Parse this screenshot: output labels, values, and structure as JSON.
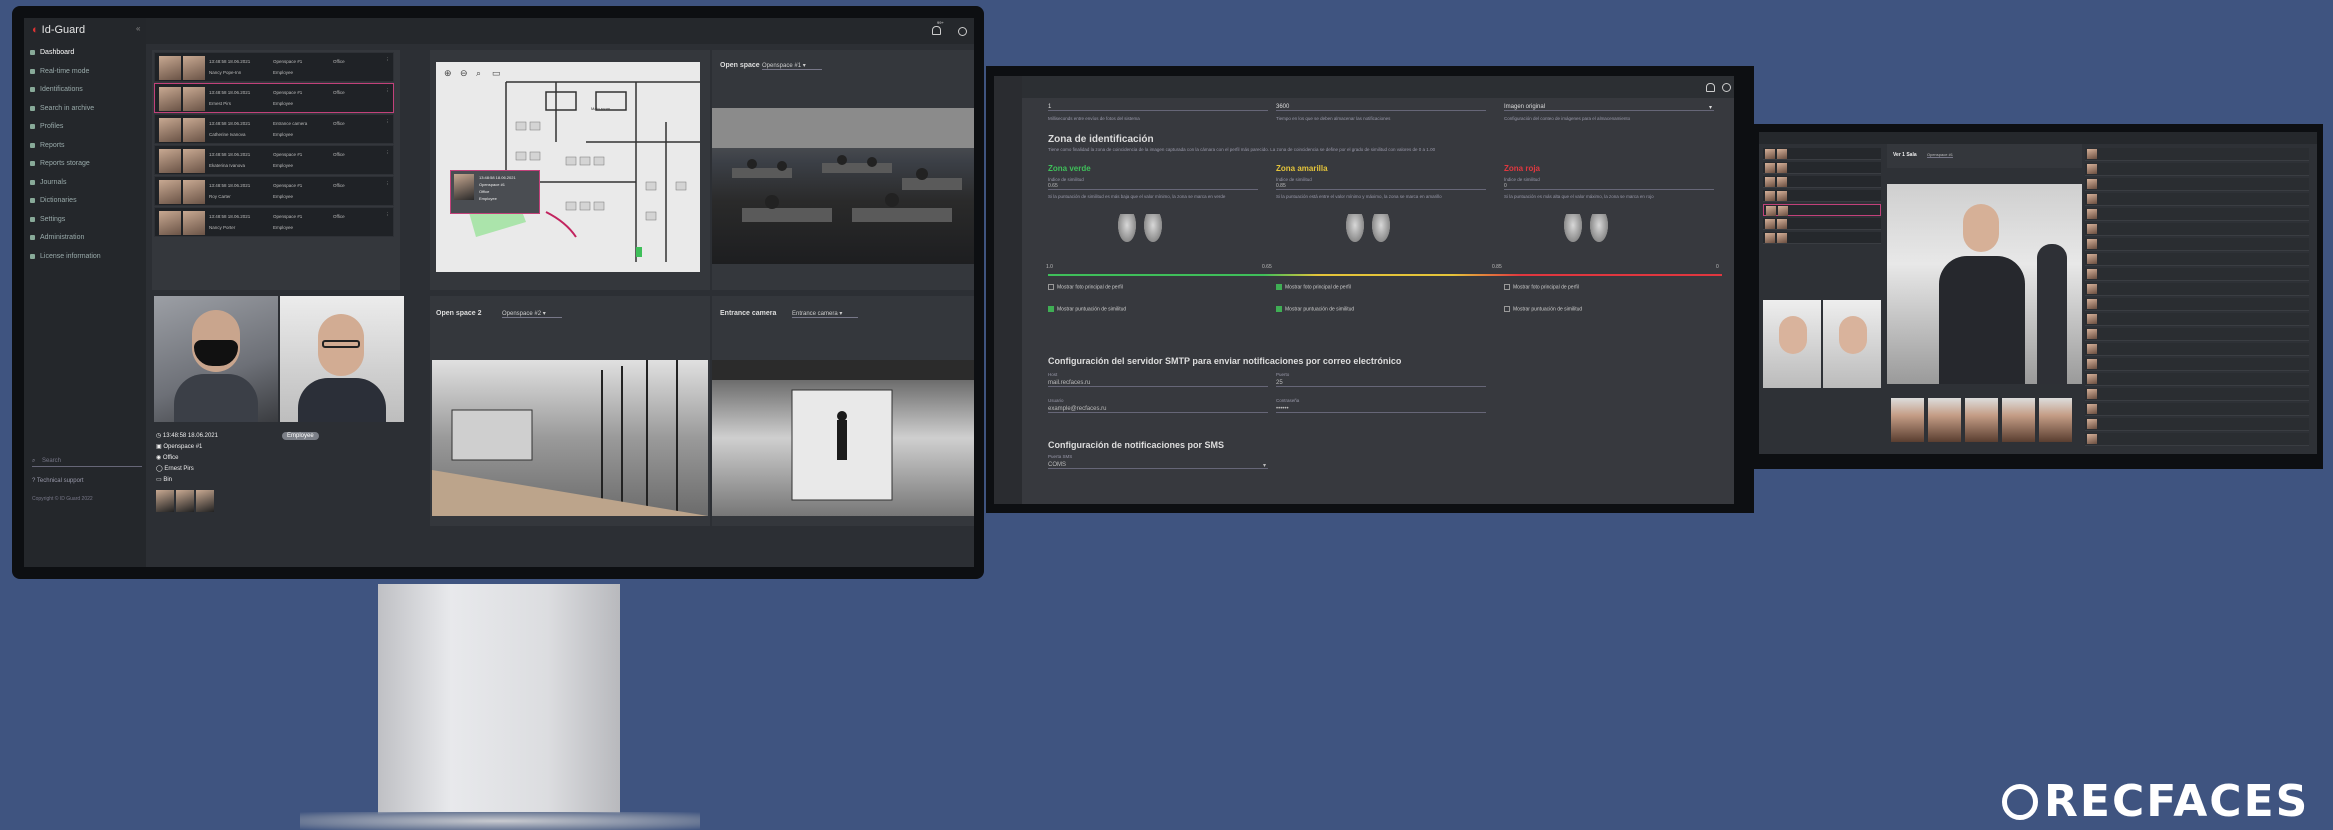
{
  "app": {
    "name": "Id-Guard",
    "copyright": "Copyright © ID Guard 2022",
    "notif_count": "99+"
  },
  "sidebar": {
    "items": [
      {
        "label": "Dashboard",
        "active": true
      },
      {
        "label": "Real-time mode"
      },
      {
        "label": "Identifications"
      },
      {
        "label": "Search in archive"
      },
      {
        "label": "Profiles"
      },
      {
        "label": "Reports"
      },
      {
        "label": "Reports storage"
      },
      {
        "label": "Journals"
      },
      {
        "label": "Dictionaries"
      },
      {
        "label": "Settings"
      },
      {
        "label": "Administration"
      },
      {
        "label": "License information"
      }
    ],
    "search_placeholder": "Search",
    "support": "Technical support"
  },
  "events": [
    {
      "time": "13:48:58 18.06.2021",
      "zone": "Openspace #1",
      "name": "Nancy Pope-Inn",
      "role": "Employee",
      "location": "Office"
    },
    {
      "time": "13:48:58 18.06.2021",
      "zone": "Openspace #1",
      "name": "Ernest Pirs",
      "role": "Employee",
      "location": "Office"
    },
    {
      "time": "13:48:58 18.06.2021",
      "zone": "Entrance camera",
      "name": "Catherine Ivanova",
      "role": "Employee",
      "location": "Office"
    },
    {
      "time": "13:48:58 18.06.2021",
      "zone": "Openspace #1",
      "name": "Ekaterina Ivanova",
      "role": "Employee",
      "location": "Office"
    },
    {
      "time": "13:48:58 18.06.2021",
      "zone": "Openspace #1",
      "name": "Roy Carter",
      "role": "Employee",
      "location": "Office"
    },
    {
      "time": "13:48:58 18.06.2021",
      "zone": "Openspace #1",
      "name": "Nancy Porter",
      "role": "Employee",
      "location": "Office"
    }
  ],
  "map_popup": {
    "time": "13:48:58 18.06.2021",
    "zone": "Openspace #1",
    "location": "Office",
    "role": "Employee"
  },
  "map_room": "Main room",
  "cameras": [
    {
      "title": "Open space",
      "select": "Openspace #1"
    },
    {
      "title": "Open space 2",
      "select": "Openspace #2"
    },
    {
      "title": "Entrance camera",
      "select": "Entrance camera"
    }
  ],
  "detail": {
    "badge": "Employee",
    "time": "13:48:58 18.06.2021",
    "zone": "Openspace #1",
    "location": "Office",
    "name": "Ernest Pirs",
    "role": "Bin"
  },
  "settings": {
    "top_fields": [
      {
        "value": "1",
        "help": "Milliseconds entre envíos de fotos del sistema"
      },
      {
        "value": "3600",
        "help": "Tiempo en los que se deben almacenar las notificaciones"
      },
      {
        "value": "Imagen original",
        "help": "Configuración del conteo de imágenes para el almacenamiento"
      }
    ],
    "section_title": "Zona de identificación",
    "section_desc": "Tiene como finalidad la zona de coincidencia de la imagen capturada con la cámara con el perfil más parecido. La zona de coincidencia se define por el grado de similitud con valores de 0 a 1.00",
    "zones": [
      {
        "title": "Zona verde",
        "color": "#3fbf5a",
        "label": "Índice de similitud",
        "value": "0.65",
        "desc": "Si la puntuación de similitud es más baja que el valor mínimo, la zona se marca en verde",
        "show_photo": "Mostrar foto principal de perfil",
        "show_score": "Mostrar puntuación de similitud",
        "photo_checked": false,
        "score_checked": true
      },
      {
        "title": "Zona amarilla",
        "color": "#e4c43a",
        "label": "Índice de similitud",
        "value": "0.85",
        "desc": "Si la puntuación está entre el valor mínimo y máximo, la zona se marca en amarillo",
        "show_photo": "Mostrar foto principal de perfil",
        "show_score": "Mostrar puntuación de similitud",
        "photo_checked": true,
        "score_checked": true
      },
      {
        "title": "Zona roja",
        "color": "#e0373f",
        "label": "Índice de similitud",
        "value": "0",
        "desc": "Si la puntuación es más alta que el valor máximo, la zona se marca en rojo",
        "show_photo": "Mostrar foto principal de perfil",
        "show_score": "Mostrar puntuación de similitud",
        "photo_checked": false,
        "score_checked": false
      }
    ],
    "scale": [
      "1.0",
      "0.65",
      "0.85",
      "0"
    ],
    "smtp_title": "Configuración del servidor SMTP para enviar notificaciones por correo electrónico",
    "smtp": {
      "host_label": "Host",
      "host": "mail.recfaces.ru",
      "port_label": "Puerto",
      "port": "25",
      "user_label": "Usuario",
      "user": "example@recfaces.ru",
      "pass_label": "Contraseña",
      "pass": "••••••"
    },
    "sms_title": "Configuración de notificaciones por SMS",
    "sms": {
      "label": "Puerta SMS",
      "value": "COMS"
    }
  },
  "screen3": {
    "title": "Ver 1 Sala",
    "select": "Openspace #1"
  },
  "brand": "RECFACES"
}
